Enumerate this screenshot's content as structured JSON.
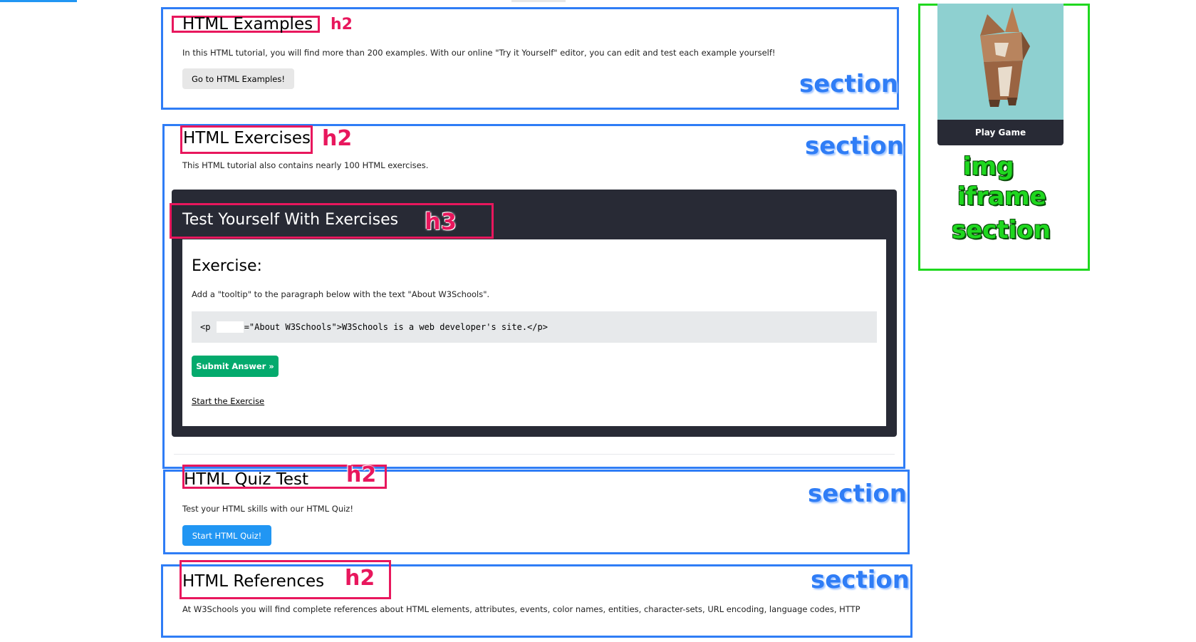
{
  "sections": {
    "examples": {
      "heading": "HTML Examples",
      "text": "In this HTML tutorial, you will find more than 200 examples. With our online \"Try it Yourself\" editor, you can edit and test each example yourself!",
      "button": "Go to HTML Examples!"
    },
    "exercises": {
      "heading": "HTML Exercises",
      "text": "This HTML tutorial also contains nearly 100 HTML exercises.",
      "panel_title": "Test Yourself With Exercises",
      "exercise_title": "Exercise:",
      "instruction": "Add a \"tooltip\" to the paragraph below with the text \"About W3Schools\".",
      "code_prefix": "<p ",
      "code_suffix": "=\"About W3Schools\">W3Schools is a web developer's site.</p>",
      "submit_button": "Submit Answer »",
      "start_link": "Start the Exercise"
    },
    "quiz": {
      "heading": "HTML Quiz Test",
      "text": "Test your HTML skills with our HTML Quiz!",
      "button": "Start HTML Quiz!"
    },
    "references": {
      "heading": "HTML References",
      "text": "At W3Schools you will find complete references about HTML elements, attributes, events, color names, entities, character-sets, URL encoding, language codes, HTTP"
    }
  },
  "sidebar": {
    "game_button": "Play Game"
  },
  "annotations": {
    "h2": "h2",
    "h3": "h3",
    "section": "section",
    "side_labels": [
      "img",
      "iframe",
      "section"
    ]
  },
  "colors": {
    "section_outline": "#2f7df6",
    "heading_outline": "#e8175d",
    "sidebar_outline": "#1fd81f",
    "accent_green": "#04aa6d",
    "accent_blue": "#2196f3",
    "dark_panel": "#282a35"
  },
  "icons": {
    "game_image": "low-poly-fox-icon"
  }
}
